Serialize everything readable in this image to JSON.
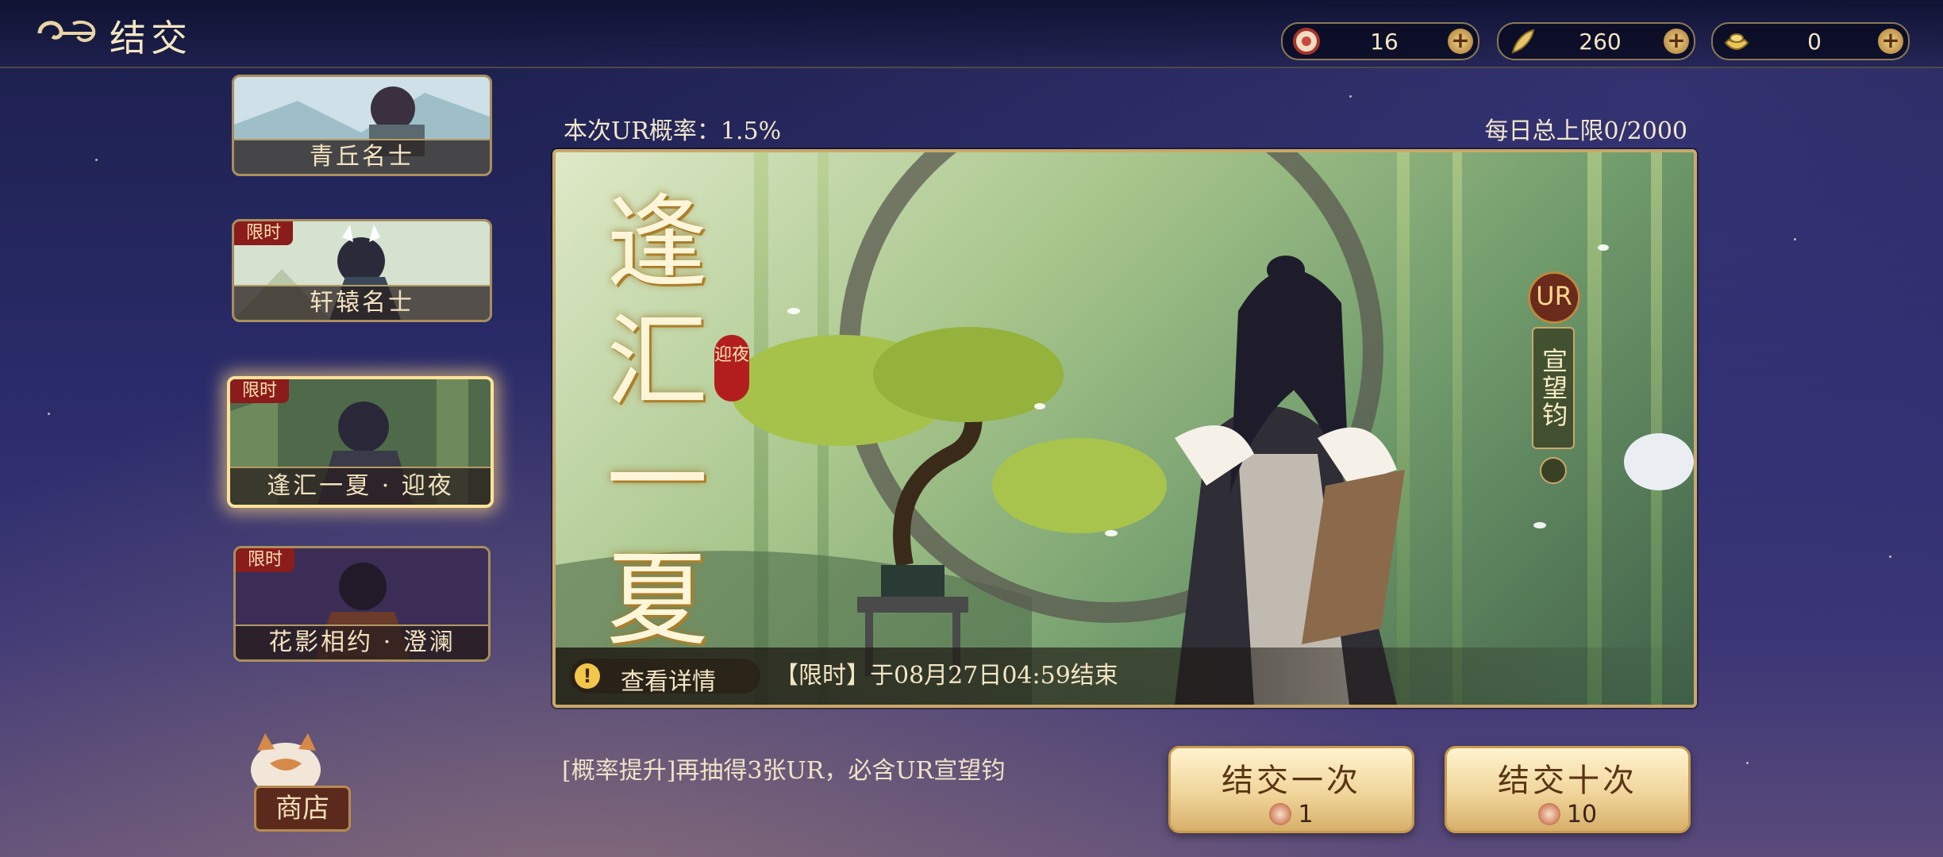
{
  "header": {
    "title": "结交"
  },
  "resources": [
    {
      "icon": "summon-token-icon",
      "value": "16"
    },
    {
      "icon": "gold-feather-icon",
      "value": "260"
    },
    {
      "icon": "gold-ingot-icon",
      "value": "0"
    }
  ],
  "banners": [
    {
      "label": "青丘名士",
      "tag": ""
    },
    {
      "label": "轩辕名士",
      "tag": "限时"
    },
    {
      "label": "逢汇一夏 · 迎夜",
      "tag": "限时",
      "selected": true
    },
    {
      "label": "花影相约 · 澄澜",
      "tag": "限时"
    }
  ],
  "shop": {
    "label": "商店"
  },
  "rate": {
    "text": "本次UR概率：1.5%",
    "daily_limit": "每日总上限0/2000"
  },
  "main_banner": {
    "title_chars": [
      "逢",
      "汇",
      "一",
      "夏"
    ],
    "seal": "迎夜",
    "ur_badge": "UR",
    "ur_name": "宣望钧",
    "detail": "查看详情",
    "time": "【限时】于08月27日04:59结束"
  },
  "boost_text": "[概率提升]再抽得3张UR，必含UR宣望钧",
  "buttons": {
    "once": {
      "label": "结交一次",
      "cost": "1"
    },
    "ten": {
      "label": "结交十次",
      "cost": "10"
    }
  }
}
